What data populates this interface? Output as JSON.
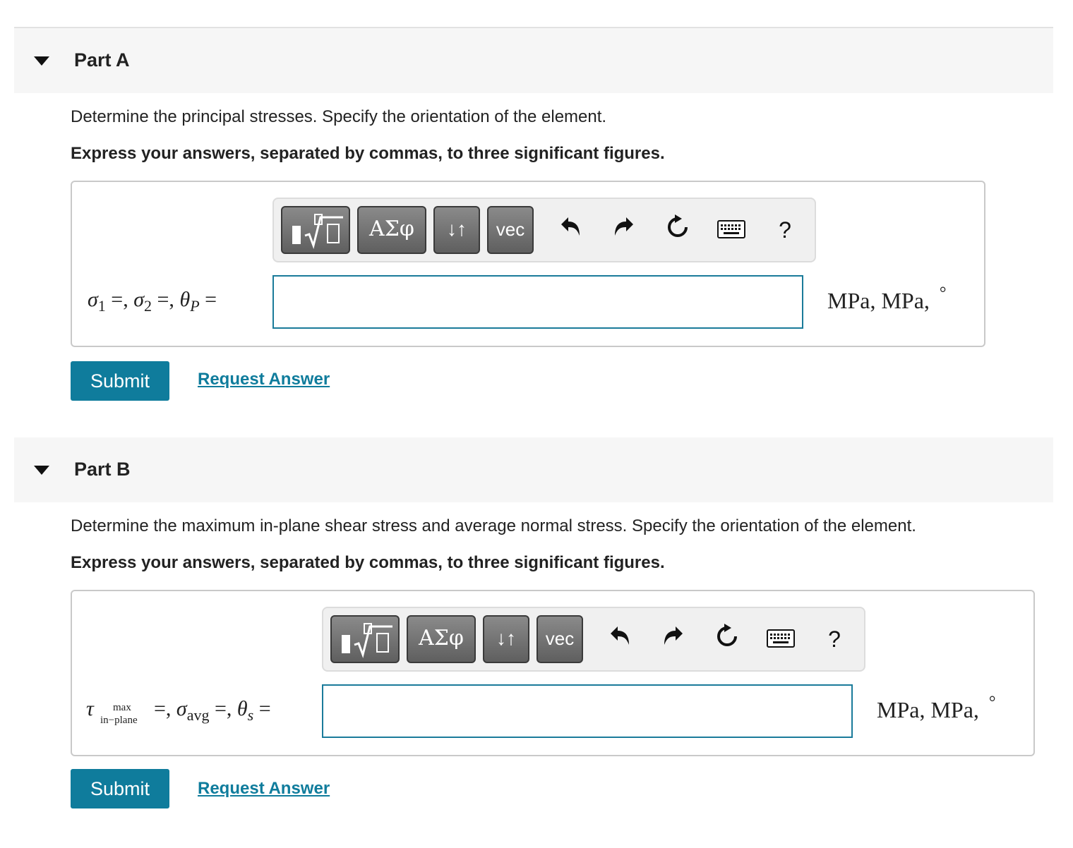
{
  "partA": {
    "title": "Part A",
    "question": "Determine the principal stresses. Specify the orientation of the element.",
    "instruction": "Express your answers, separated by commas, to three significant figures.",
    "toolbar": {
      "greek": "ΑΣφ",
      "arrows": "↓↑",
      "vec": "vec",
      "help": "?"
    },
    "answer_value": "",
    "units_text": "MPa,  MPa,",
    "degree": "°",
    "submit_label": "Submit",
    "request_label": "Request Answer"
  },
  "partB": {
    "title": "Part B",
    "question": "Determine the maximum in-plane shear stress and average normal stress. Specify the orientation of the element.",
    "instruction": "Express your answers, separated by commas, to three significant figures.",
    "toolbar": {
      "greek": "ΑΣφ",
      "arrows": "↓↑",
      "vec": "vec",
      "help": "?"
    },
    "label_max": "max",
    "label_inplane": "in−plane",
    "answer_value": "",
    "units_text": "MPa,  MPa,",
    "degree": "°",
    "submit_label": "Submit",
    "request_label": "Request Answer"
  }
}
